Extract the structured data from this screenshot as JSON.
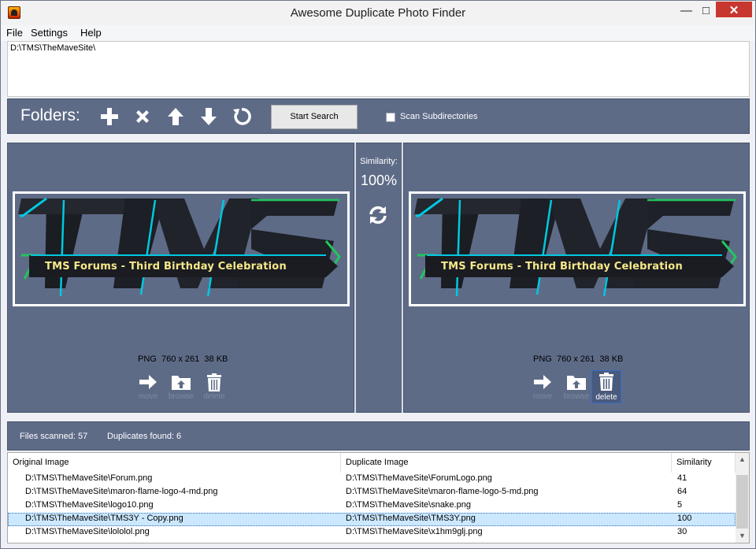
{
  "window": {
    "title": "Awesome Duplicate Photo Finder",
    "min": "—",
    "max": "□",
    "close": "✕"
  },
  "menu": {
    "items": [
      {
        "label": "File"
      },
      {
        "label": "Settings"
      },
      {
        "label": "Help"
      }
    ]
  },
  "folders": {
    "paths": [
      "D:\\TMS\\TheMaveSite\\"
    ]
  },
  "toolbar": {
    "label": "Folders:",
    "icons": [
      "plus-icon",
      "close-icon",
      "arrow-up-icon",
      "arrow-down-icon",
      "reset-icon"
    ],
    "start_search": "Start Search",
    "scan_subdirs_label": "Scan Subdirectories",
    "scan_subdirs_checked": false
  },
  "compare": {
    "similarity_label": "Similarity:",
    "similarity_value": "100%",
    "banner_text": "TMS Forums - Third Birthday Celebration",
    "left": {
      "format": "PNG",
      "dims": "760 x 261",
      "size": "38 KB",
      "move": "move",
      "browse": "browse",
      "delete": "delete"
    },
    "right": {
      "format": "PNG",
      "dims": "760 x 261",
      "size": "38 KB",
      "move": "move",
      "browse": "browse",
      "delete": "delete"
    }
  },
  "status": {
    "files_scanned": "Files scanned:  57",
    "duplicates_found": "Duplicates found:  6"
  },
  "table": {
    "headers": [
      "Original Image",
      "Duplicate Image",
      "Similarity"
    ],
    "rows": [
      {
        "original": "D:\\TMS\\TheMaveSite\\Forum.png",
        "duplicate": "D:\\TMS\\TheMaveSite\\ForumLogo.png",
        "similarity": "41"
      },
      {
        "original": "D:\\TMS\\TheMaveSite\\maron-flame-logo-4-md.png",
        "duplicate": "D:\\TMS\\TheMaveSite\\maron-flame-logo-5-md.png",
        "similarity": "64"
      },
      {
        "original": "D:\\TMS\\TheMaveSite\\logo10.png",
        "duplicate": "D:\\TMS\\TheMaveSite\\snake.png",
        "similarity": "5"
      },
      {
        "original": "D:\\TMS\\TheMaveSite\\TMS3Y - Copy.png",
        "duplicate": "D:\\TMS\\TheMaveSite\\TMS3Y.png",
        "similarity": "100"
      },
      {
        "original": "D:\\TMS\\TheMaveSite\\lololol.png",
        "duplicate": "D:\\TMS\\TheMaveSite\\x1hm9glj.png",
        "similarity": "30"
      }
    ],
    "selected_row": 3
  },
  "colors": {
    "panel": "#5e6b87",
    "banner_text": "#f7e88a",
    "accent_cyan": "#00c8e0",
    "accent_green": "#22c55e"
  }
}
